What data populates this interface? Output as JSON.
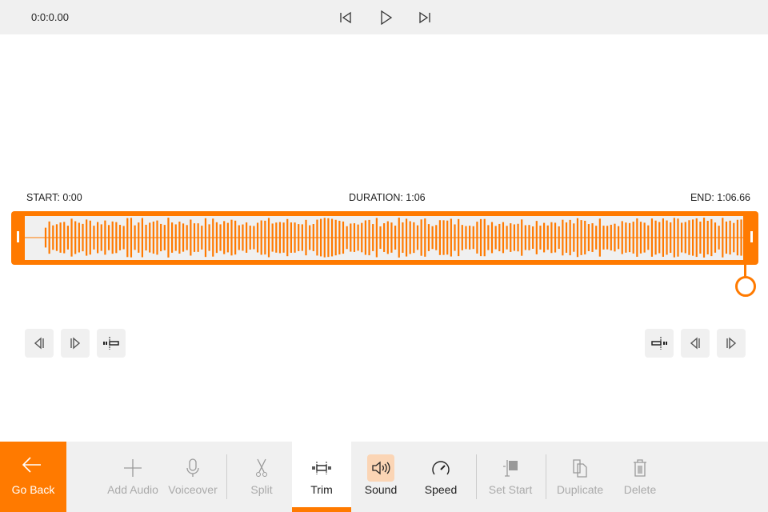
{
  "player": {
    "time": "0:0:0.00"
  },
  "trim": {
    "start": "START: 0:00",
    "duration": "DURATION:  1:06",
    "end": "END: 1:06.66"
  },
  "toolbar": {
    "go_back": "Go Back",
    "items": [
      {
        "label": "Add Audio",
        "icon": "plus-icon",
        "enabled": false
      },
      {
        "label": "Voiceover",
        "icon": "microphone-icon",
        "enabled": false
      },
      {
        "label": "Split",
        "icon": "scissors-icon",
        "enabled": false
      },
      {
        "label": "Trim",
        "icon": "trim-icon",
        "enabled": true,
        "active": true
      },
      {
        "label": "Sound",
        "icon": "speaker-icon",
        "enabled": true
      },
      {
        "label": "Speed",
        "icon": "speedometer-icon",
        "enabled": true
      },
      {
        "label": "Set Start",
        "icon": "set-start-icon",
        "enabled": false
      },
      {
        "label": "Duplicate",
        "icon": "duplicate-icon",
        "enabled": false
      },
      {
        "label": "Delete",
        "icon": "trash-icon",
        "enabled": false
      }
    ]
  },
  "colors": {
    "accent": "#ff7a00",
    "panel": "#f0f0f0"
  }
}
